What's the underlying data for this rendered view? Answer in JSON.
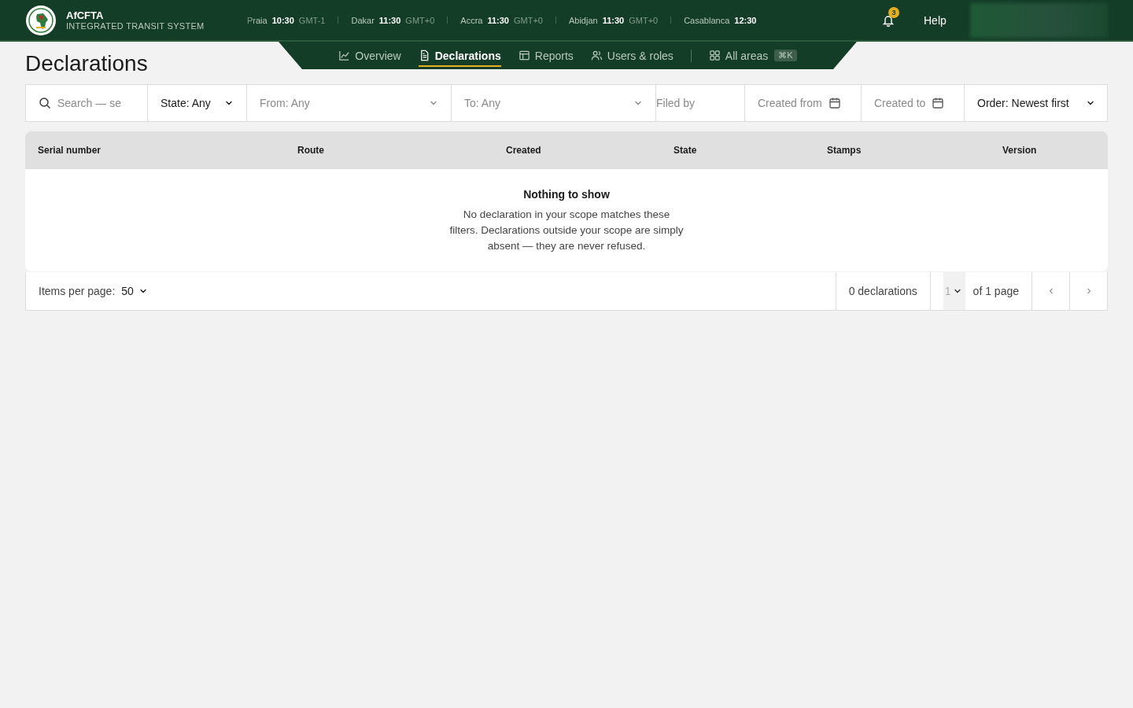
{
  "brand": {
    "name": "AfCFTA",
    "subtitle": "INTEGRATED TRANSIT SYSTEM"
  },
  "clocks": [
    {
      "city": "Praia",
      "time": "10:30",
      "zone": "GMT-1"
    },
    {
      "city": "Dakar",
      "time": "11:30",
      "zone": "GMT+0"
    },
    {
      "city": "Accra",
      "time": "11:30",
      "zone": "GMT+0"
    },
    {
      "city": "Abidjan",
      "time": "11:30",
      "zone": "GMT+0"
    },
    {
      "city": "Casablanca",
      "time": "12:30"
    }
  ],
  "notifications": {
    "count": "3"
  },
  "help": "Help",
  "nav": [
    {
      "label": "Overview",
      "kind": "chart",
      "selected": false
    },
    {
      "label": "Declarations",
      "kind": "document",
      "selected": true
    },
    {
      "label": "Reports",
      "kind": "table",
      "selected": false
    },
    {
      "label": "Users & roles",
      "kind": "users",
      "selected": false
    },
    {
      "label": "All areas",
      "kind": "grid",
      "selected": false,
      "shortcut": "⌘K"
    }
  ],
  "page_title": "Declarations",
  "filters": [
    {
      "kind": "search",
      "placeholder": "Search — se"
    },
    {
      "kind": "select",
      "value": "State: Any"
    },
    {
      "kind": "select",
      "placeholder": "From: Any"
    },
    {
      "kind": "select",
      "placeholder": "To: Any"
    },
    {
      "kind": "text",
      "placeholder": "Filed by"
    },
    {
      "kind": "date",
      "placeholder": "Created from"
    },
    {
      "kind": "date",
      "placeholder": "Created to"
    },
    {
      "kind": "select",
      "value": "Order: Newest first"
    }
  ],
  "table": {
    "columns": [
      "Serial number",
      "Route",
      "Created",
      "State",
      "Stamps",
      "Version"
    ],
    "empty": {
      "title": "Nothing to show",
      "message": "No declaration in your scope matches these filters. Declarations outside your scope are simply absent — they are never refused."
    }
  },
  "footer": {
    "items_per_page_label": "Items per page:",
    "items_per_page": "50",
    "total": "0 declarations",
    "page": "1",
    "page_count": "of 1 page"
  }
}
